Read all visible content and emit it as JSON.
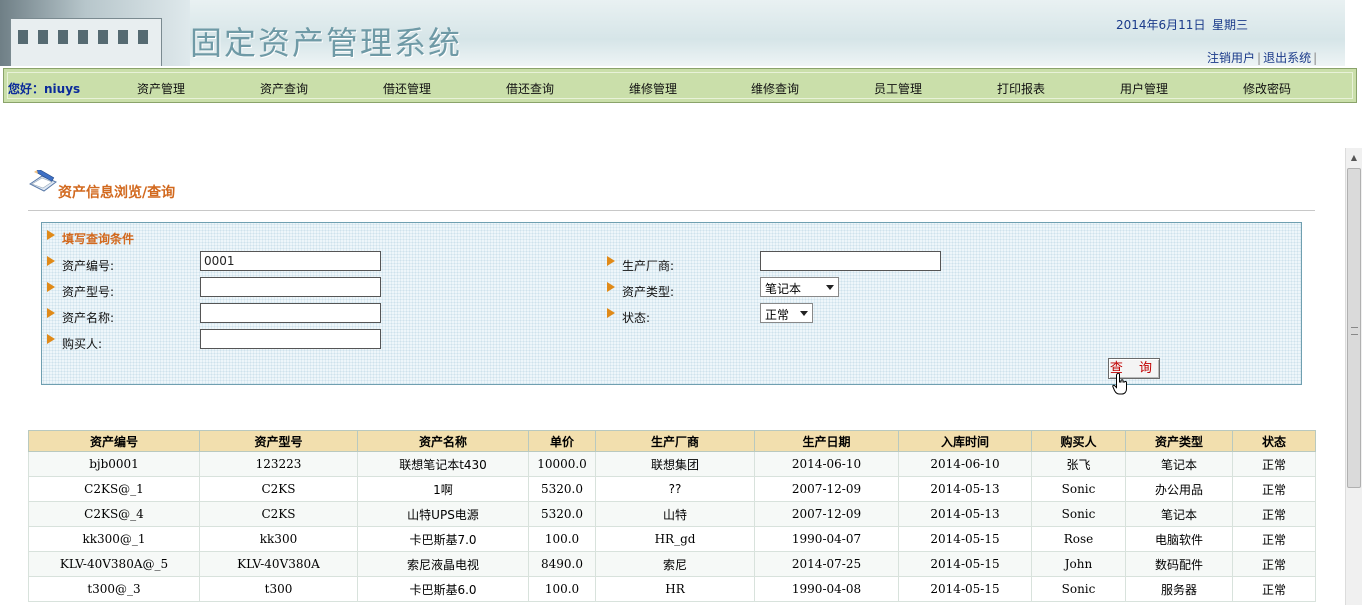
{
  "header": {
    "system_title": "固定资产管理系统",
    "date": "2014年6月11日",
    "weekday": "星期三",
    "logout_user": "注销用户",
    "exit_system": "退出系统",
    "separator": "|"
  },
  "nav": {
    "greeting": "您好：niuys",
    "items": [
      "资产管理",
      "资产查询",
      "借还管理",
      "借还查询",
      "维修管理",
      "维修查询",
      "员工管理",
      "打印报表",
      "用户管理",
      "修改密码"
    ]
  },
  "section": {
    "title": "资产信息浏览/查询"
  },
  "query": {
    "heading": "填写查询条件",
    "asset_no_label": "资产编号:",
    "asset_no_value": "0001",
    "model_label": "资产型号:",
    "model_value": "",
    "name_label": "资产名称:",
    "name_value": "",
    "buyer_label": "购买人:",
    "buyer_value": "",
    "maker_label": "生产厂商:",
    "maker_value": "",
    "type_label": "资产类型:",
    "type_selected": "笔记本",
    "status_label": "状态:",
    "status_selected": "正常",
    "submit_label": "查 询"
  },
  "table": {
    "columns": [
      "资产编号",
      "资产型号",
      "资产名称",
      "单价",
      "生产厂商",
      "生产日期",
      "入库时间",
      "购买人",
      "资产类型",
      "状态"
    ],
    "rows": [
      [
        "bjb0001",
        "123223",
        "联想笔记本t430",
        "10000.0",
        "联想集团",
        "2014-06-10",
        "2014-06-10",
        "张飞",
        "笔记本",
        "正常"
      ],
      [
        "C2KS@_1",
        "C2KS",
        "1啊",
        "5320.0",
        "??",
        "2007-12-09",
        "2014-05-13",
        "Sonic",
        "办公用品",
        "正常"
      ],
      [
        "C2KS@_4",
        "C2KS",
        "山特UPS电源",
        "5320.0",
        "山特",
        "2007-12-09",
        "2014-05-13",
        "Sonic",
        "笔记本",
        "正常"
      ],
      [
        "kk300@_1",
        "kk300",
        "卡巴斯基7.0",
        "100.0",
        "HR_gd",
        "1990-04-07",
        "2014-05-15",
        "Rose",
        "电脑软件",
        "正常"
      ],
      [
        "KLV-40V380A@_5",
        "KLV-40V380A",
        "索尼液晶电视",
        "8490.0",
        "索尼",
        "2014-07-25",
        "2014-05-15",
        "John",
        "数码配件",
        "正常"
      ],
      [
        "t300@_3",
        "t300",
        "卡巴斯基6.0",
        "100.0",
        "HR",
        "1990-04-08",
        "2014-05-15",
        "Sonic",
        "服务器",
        "正常"
      ]
    ]
  },
  "icons": {
    "section_icon": "pencil-notepad-icon",
    "bullet_icon": "orange-arrow-icon",
    "cursor_icon": "hand-pointer-icon"
  },
  "colors": {
    "nav_bg": "#cadfaa",
    "table_header_bg": "#f2dfae",
    "accent_orange": "#d2691e",
    "link_blue": "#1a3a8a"
  }
}
